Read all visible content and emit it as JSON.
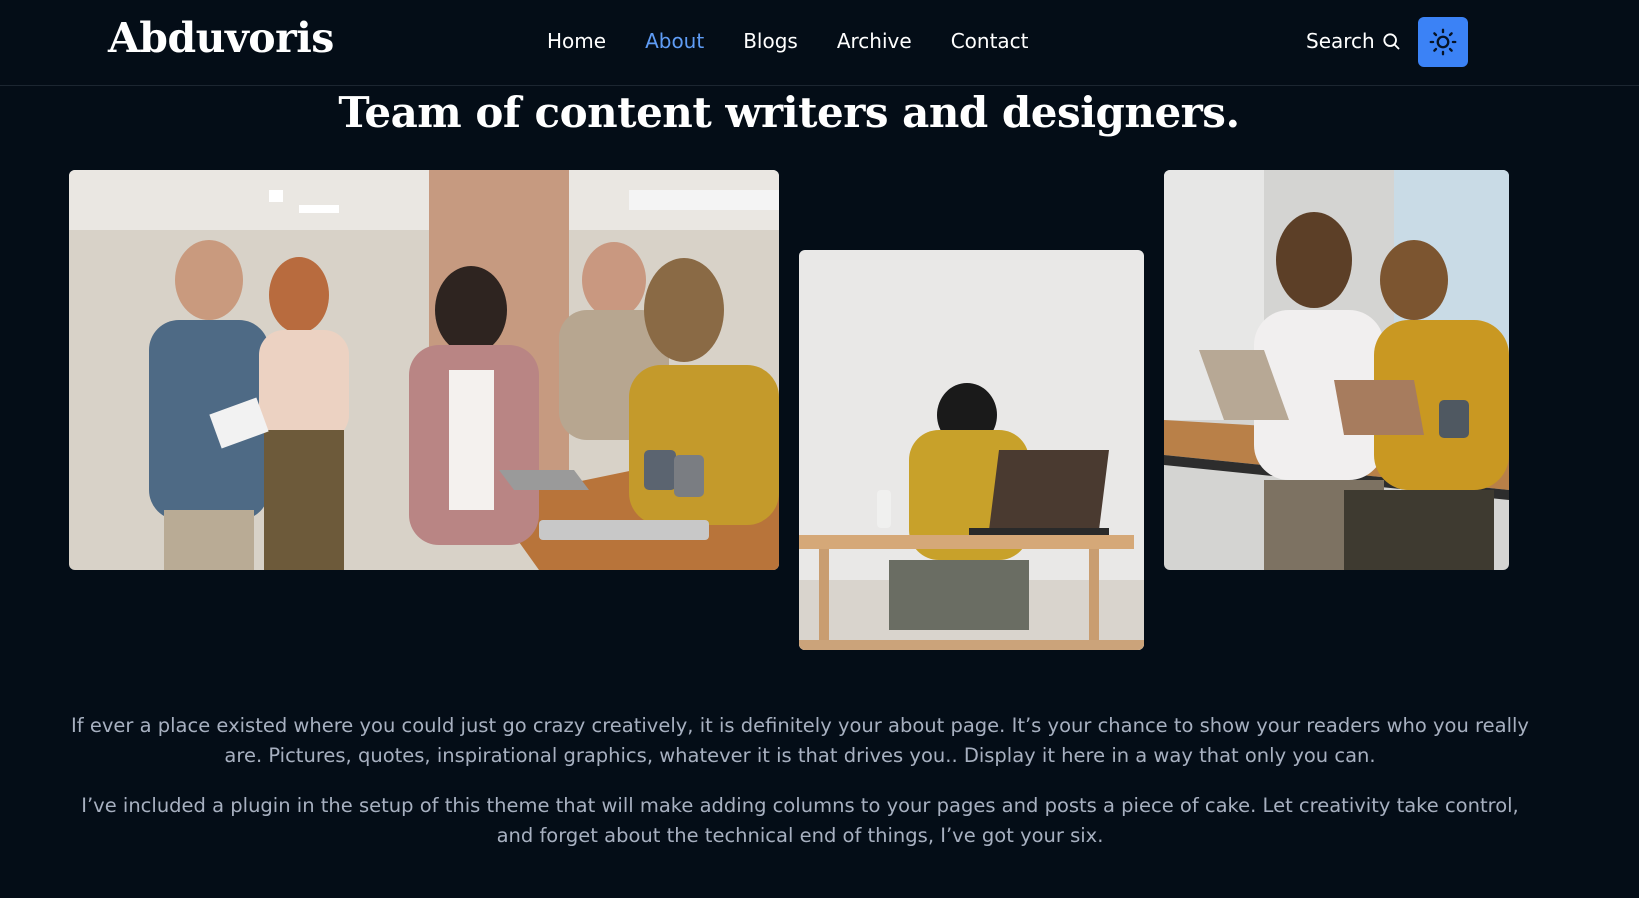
{
  "header": {
    "brand": "Abduvoris",
    "nav": [
      {
        "label": "Home",
        "active": false
      },
      {
        "label": "About",
        "active": true
      },
      {
        "label": "Blogs",
        "active": false
      },
      {
        "label": "Archive",
        "active": false
      },
      {
        "label": "Contact",
        "active": false
      }
    ],
    "search_label": "Search",
    "search_icon": "search-icon",
    "theme_icon": "sun-icon"
  },
  "main": {
    "heading": "Team of content writers and designers.",
    "images": [
      {
        "alt": "team-meeting-photo"
      },
      {
        "alt": "person-working-on-laptop-photo"
      },
      {
        "alt": "two-people-with-laptop-photo"
      }
    ],
    "paragraphs": [
      "If ever a place existed where you could just go crazy creatively, it is definitely your about page. It’s your chance to show your readers who you really are. Pictures, quotes, inspirational graphics, whatever it is that drives you.. Display it here in a way that only you can.",
      "I’ve included a plugin in the setup of this theme that will make adding columns to your pages and posts a piece of cake. Let creativity take control, and forget about the technical end of things, I’ve got your six."
    ]
  },
  "colors": {
    "background": "#040d17",
    "accent": "#3b82f6",
    "active_link": "#5f9cf5",
    "body_text": "#a7b0c0"
  }
}
